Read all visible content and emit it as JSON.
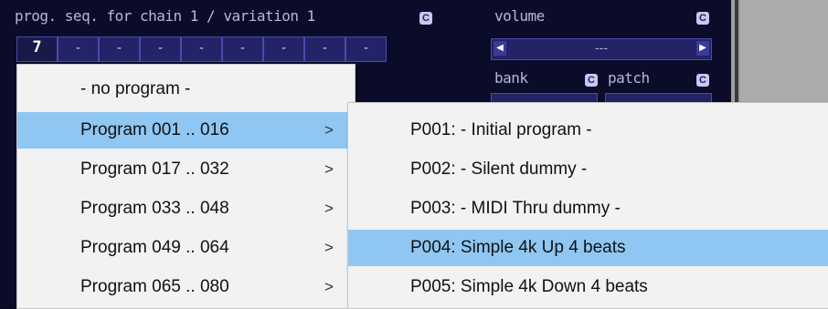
{
  "sequence": {
    "header": "prog. seq. for chain 1 / variation 1",
    "header_icon": "C",
    "cells": [
      "7",
      "-",
      "-",
      "-",
      "-",
      "-",
      "-",
      "-",
      "-"
    ]
  },
  "volume": {
    "label": "volume",
    "icon": "C",
    "value": "---",
    "left_arrow": "◀",
    "right_arrow": "▶"
  },
  "bank": {
    "label": "bank",
    "icon": "C"
  },
  "patch": {
    "label": "patch",
    "icon": "C"
  },
  "program_menu": {
    "items": [
      {
        "label": "- no program -",
        "submenu": false
      },
      {
        "label": "Program 001 .. 016",
        "submenu": true,
        "arrow": ">"
      },
      {
        "label": "Program 017 .. 032",
        "submenu": true,
        "arrow": ">"
      },
      {
        "label": "Program 033 .. 048",
        "submenu": true,
        "arrow": ">"
      },
      {
        "label": "Program 049 .. 064",
        "submenu": true,
        "arrow": ">"
      },
      {
        "label": "Program 065 .. 080",
        "submenu": true,
        "arrow": ">"
      }
    ]
  },
  "program_submenu": {
    "items": [
      {
        "label": "P001: - Initial program -"
      },
      {
        "label": "P002: - Silent dummy -"
      },
      {
        "label": "P003: - MIDI Thru dummy -"
      },
      {
        "label": "P004: Simple 4k Up 4 beats"
      },
      {
        "label": "P005: Simple 4k Down 4 beats"
      }
    ]
  },
  "colors": {
    "background": "#0b0b2a",
    "menu_bg": "#f2f2f2",
    "highlight": "#8fc7f2"
  }
}
